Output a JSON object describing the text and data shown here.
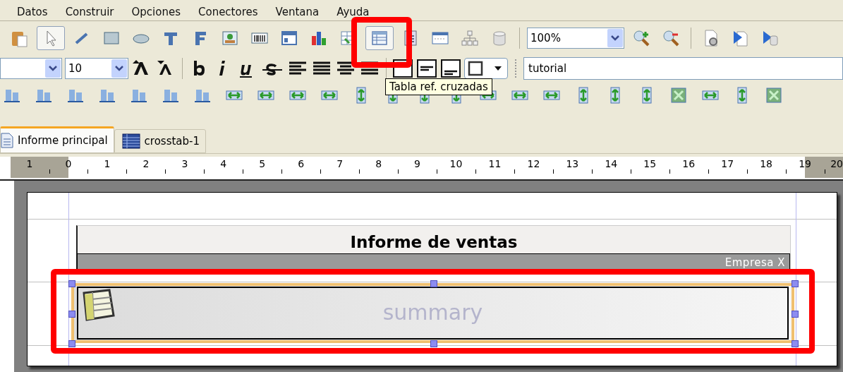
{
  "menu": [
    "Datos",
    "Construir",
    "Opciones",
    "Conectores",
    "Ventana",
    "Ayuda"
  ],
  "toolbar": {
    "tools": [
      {
        "kind": "paste",
        "selected": false
      },
      {
        "kind": "pointer",
        "selected": true
      },
      {
        "kind": "line",
        "selected": false
      },
      {
        "kind": "rectangle",
        "selected": false
      },
      {
        "kind": "ellipse",
        "selected": false
      },
      {
        "kind": "text",
        "selected": false
      },
      {
        "kind": "field",
        "selected": false
      },
      {
        "kind": "image",
        "selected": false
      },
      {
        "kind": "barcode",
        "selected": false
      },
      {
        "kind": "frame",
        "selected": false
      },
      {
        "kind": "chart",
        "selected": false
      },
      {
        "kind": "subreport",
        "selected": false
      },
      {
        "kind": "crosstab",
        "selected": true
      },
      {
        "kind": "calculator",
        "selected": false
      },
      {
        "kind": "band",
        "selected": false
      },
      {
        "kind": "tree",
        "selected": false
      },
      {
        "kind": "database",
        "selected": false
      }
    ],
    "zoom": "100%",
    "actions": [
      {
        "kind": "zoom-in",
        "selected": false
      },
      {
        "kind": "zoom-out",
        "selected": false
      },
      {
        "kind": "compile",
        "selected": false
      },
      {
        "kind": "run",
        "selected": false
      },
      {
        "kind": "run-database",
        "selected": false
      }
    ]
  },
  "format_bar": {
    "font_size": "10",
    "text_value": "tutorial"
  },
  "tooltip": "Tabla ref. cruzadas",
  "tabs": [
    {
      "label": "Informe principal",
      "selected": true,
      "kind": "report"
    },
    {
      "label": "crosstab-1",
      "selected": false,
      "kind": "crosstab"
    }
  ],
  "ruler": [
    "1",
    "0",
    "1",
    "2",
    "3",
    "4",
    "5",
    "6",
    "7",
    "8",
    "9",
    "10",
    "11",
    "12",
    "13",
    "14",
    "15",
    "16",
    "17",
    "18",
    "19",
    "20"
  ],
  "report": {
    "title": "Informe de ventas",
    "company": "Empresa X",
    "band_label": "summary",
    "crosstab_selected": true
  }
}
